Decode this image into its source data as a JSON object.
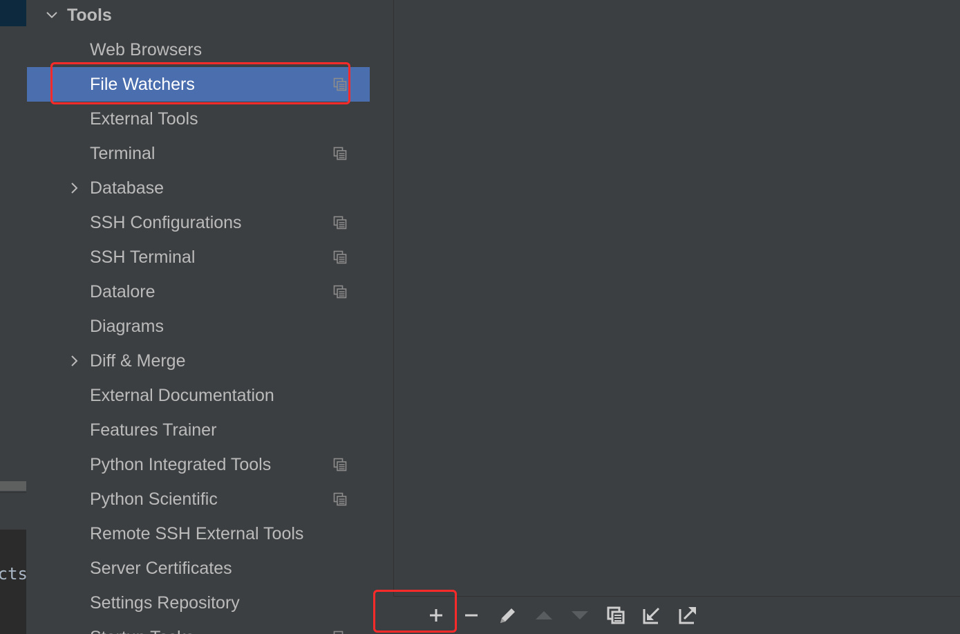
{
  "sidebar": {
    "header": {
      "label": "Tools",
      "expanded": true
    },
    "items": [
      {
        "label": "Web Browsers",
        "expandable": false,
        "project_icon": false,
        "selected": false
      },
      {
        "label": "File Watchers",
        "expandable": false,
        "project_icon": true,
        "selected": true
      },
      {
        "label": "External Tools",
        "expandable": false,
        "project_icon": false,
        "selected": false
      },
      {
        "label": "Terminal",
        "expandable": false,
        "project_icon": true,
        "selected": false
      },
      {
        "label": "Database",
        "expandable": true,
        "project_icon": false,
        "selected": false
      },
      {
        "label": "SSH Configurations",
        "expandable": false,
        "project_icon": true,
        "selected": false
      },
      {
        "label": "SSH Terminal",
        "expandable": false,
        "project_icon": true,
        "selected": false
      },
      {
        "label": "Datalore",
        "expandable": false,
        "project_icon": true,
        "selected": false
      },
      {
        "label": "Diagrams",
        "expandable": false,
        "project_icon": false,
        "selected": false
      },
      {
        "label": "Diff & Merge",
        "expandable": true,
        "project_icon": false,
        "selected": false
      },
      {
        "label": "External Documentation",
        "expandable": false,
        "project_icon": false,
        "selected": false
      },
      {
        "label": "Features Trainer",
        "expandable": false,
        "project_icon": false,
        "selected": false
      },
      {
        "label": "Python Integrated Tools",
        "expandable": false,
        "project_icon": true,
        "selected": false
      },
      {
        "label": "Python Scientific",
        "expandable": false,
        "project_icon": true,
        "selected": false
      },
      {
        "label": "Remote SSH External Tools",
        "expandable": false,
        "project_icon": false,
        "selected": false
      },
      {
        "label": "Server Certificates",
        "expandable": false,
        "project_icon": false,
        "selected": false
      },
      {
        "label": "Settings Repository",
        "expandable": false,
        "project_icon": false,
        "selected": false
      },
      {
        "label": "Startup Tasks",
        "expandable": false,
        "project_icon": true,
        "selected": false
      }
    ]
  },
  "background": {
    "code_fragment": "cts"
  },
  "toolbar": {
    "buttons": [
      {
        "name": "add-button",
        "icon": "plus-icon",
        "enabled": true
      },
      {
        "name": "remove-button",
        "icon": "minus-icon",
        "enabled": true
      },
      {
        "name": "edit-button",
        "icon": "pencil-icon",
        "enabled": true
      },
      {
        "name": "move-up-button",
        "icon": "triangle-up-icon",
        "enabled": false
      },
      {
        "name": "move-down-button",
        "icon": "triangle-down-icon",
        "enabled": false
      },
      {
        "name": "copy-button",
        "icon": "copy-icon",
        "enabled": true
      },
      {
        "name": "import-button",
        "icon": "import-icon",
        "enabled": true
      },
      {
        "name": "export-button",
        "icon": "export-icon",
        "enabled": true
      }
    ]
  },
  "colors": {
    "selection": "#4b6eaf",
    "highlight": "#ff2a2a",
    "panel": "#3c3f41",
    "text": "#bbbbbb"
  }
}
